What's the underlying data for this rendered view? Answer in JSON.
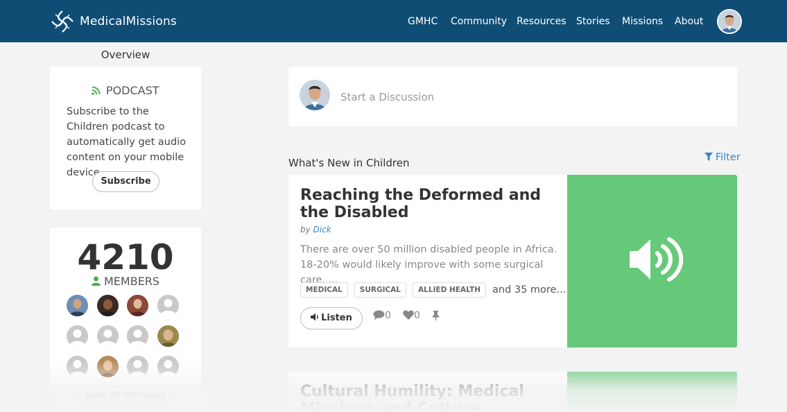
{
  "header": {
    "logo_text": "MedicalMissions",
    "nav": [
      {
        "label": "GMHC"
      },
      {
        "label": "Community"
      },
      {
        "label": "Resources"
      },
      {
        "label": "Stories"
      },
      {
        "label": "Missions"
      },
      {
        "label": "About"
      }
    ]
  },
  "sidebar": {
    "overview_label": "Overview",
    "podcast": {
      "title": "PODCAST",
      "description": "Subscribe to the Children podcast to automatically get audio content on your mobile device.",
      "button": "Subscribe"
    },
    "members": {
      "count": "4210",
      "label": "MEMBERS",
      "view_all": "View All Members"
    }
  },
  "discussion": {
    "placeholder": "Start a Discussion"
  },
  "feed": {
    "section_title": "What's New in Children",
    "filter_label": "Filter",
    "posts": [
      {
        "title": "Reaching the Deformed and the Disabled",
        "by_prefix": "by",
        "author": "Dick",
        "excerpt": "There are over 50 million disabled people in Africa. 18-20% would likely improve with some surgical care. ...",
        "tags": [
          "MEDICAL",
          "SURGICAL",
          "ALLIED HEALTH"
        ],
        "more_tags": "and 35 more...",
        "listen_label": "Listen",
        "comments": "0",
        "likes": "0"
      },
      {
        "title": "Cultural Humility: Medical Missions and Culture"
      }
    ]
  },
  "colors": {
    "header_bg": "#0f4d75",
    "accent_green": "#66c97a",
    "link_blue": "#3a84c4"
  }
}
